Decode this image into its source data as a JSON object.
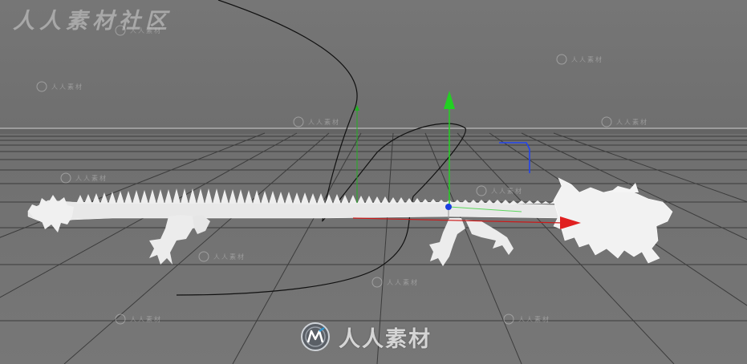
{
  "watermark": {
    "top_left_text": "人人素材社区",
    "bottom_text": "人人素材",
    "tile_text": "人人素材"
  },
  "viewport": {
    "background_color": "#737373",
    "horizon_color": "#c8c8c8",
    "grid_color": "#3a3a3a"
  },
  "scene": {
    "model_name": "dragon-wireframe",
    "model_color": "#eeeeee",
    "spline_color": "#111111",
    "axis_colors": {
      "x": "#e02020",
      "y": "#22d022",
      "z": "#2244ee"
    }
  }
}
